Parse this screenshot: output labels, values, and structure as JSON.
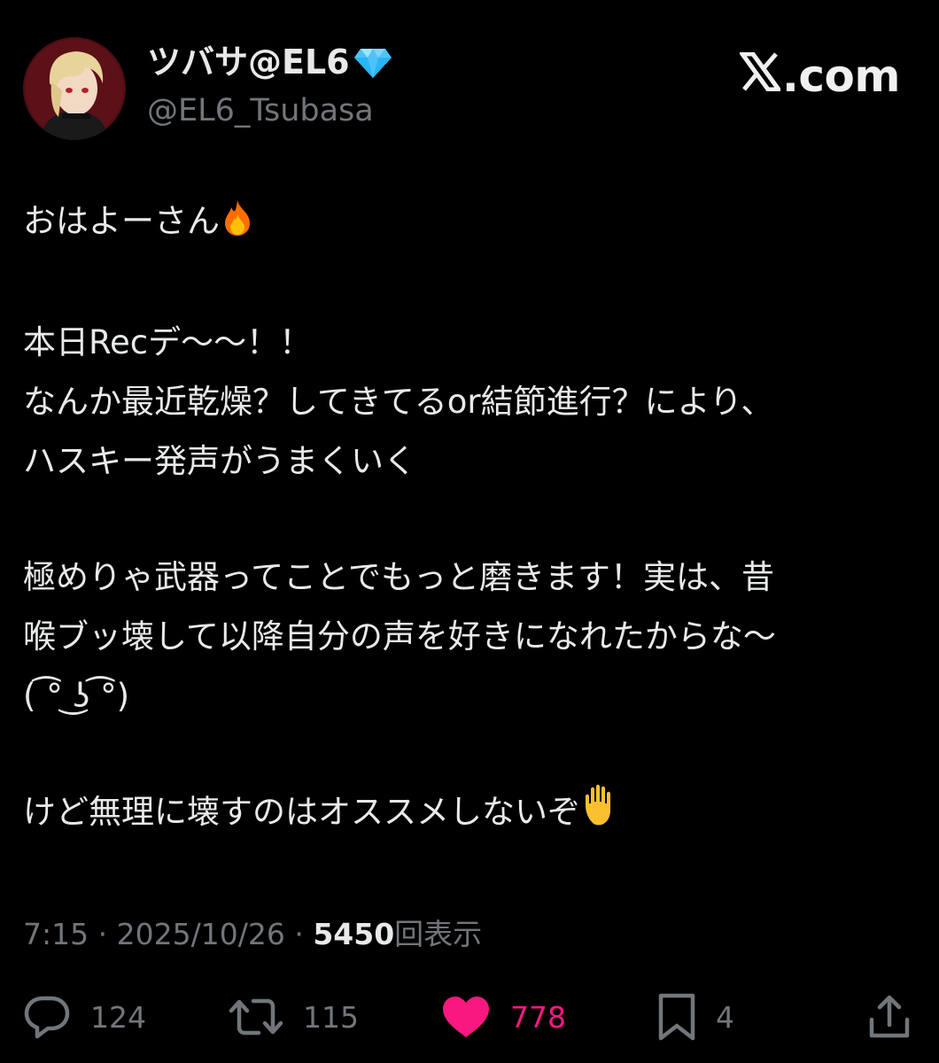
{
  "author": {
    "display_name": "ツバサ@EL6",
    "handle": "@EL6_Tsubasa",
    "verified_icon": "gem-icon"
  },
  "brand": {
    "text": ".com",
    "logo_icon": "x-logo-icon"
  },
  "post": {
    "lines": [
      "おはよーさん",
      "本日Recデ〜〜！！",
      "なんか最近乾燥？してきてるor結節進行？により、",
      "ハスキー発声がうまくいく",
      "極めりゃ武器ってことでもっと磨きます！実は、昔",
      "喉ブッ壊して以降自分の声を好きになれたからな〜",
      "( ͡° ͜ʖ ͡°)",
      "けど無理に壊すのはオススメしないぞ"
    ]
  },
  "meta": {
    "time": "7:15",
    "separator": "·",
    "date": "2025/10/26",
    "views_count": "5450",
    "views_label": "回表示"
  },
  "actions": {
    "replies": "124",
    "reposts": "115",
    "likes": "778",
    "bookmarks": "4"
  },
  "colors": {
    "background": "#000000",
    "text": "#e7e9ea",
    "secondary": "#71767b",
    "like": "#f91880",
    "verified": "#4fc3f7"
  }
}
